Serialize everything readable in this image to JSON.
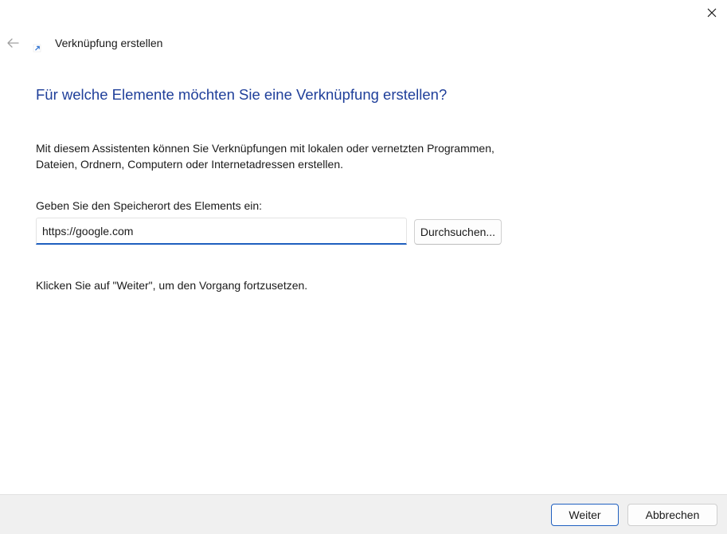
{
  "window": {
    "title": "Verknüpfung erstellen",
    "close_icon": "close-icon",
    "back_icon": "back-arrow-icon",
    "title_icon": "shortcut-arrow-icon"
  },
  "wizard": {
    "heading": "Für welche Elemente möchten Sie eine Verknüpfung erstellen?",
    "description_line1": "Mit diesem Assistenten können Sie Verknüpfungen mit lokalen oder vernetzten Programmen,",
    "description_line2": "Dateien, Ordnern, Computern oder Internetadressen erstellen.",
    "location_label": "Geben Sie den Speicherort des Elements ein:",
    "location_value": "https://google.com",
    "browse_label": "Durchsuchen...",
    "continue_hint": "Klicken Sie auf \"Weiter\", um den Vorgang fortzusetzen."
  },
  "footer": {
    "next_label": "Weiter",
    "cancel_label": "Abbrechen"
  },
  "colors": {
    "heading": "#1f3f9a",
    "accent": "#1f5fbf",
    "footer_bg": "#f0f0f0",
    "window_bg": "#ffffff"
  }
}
